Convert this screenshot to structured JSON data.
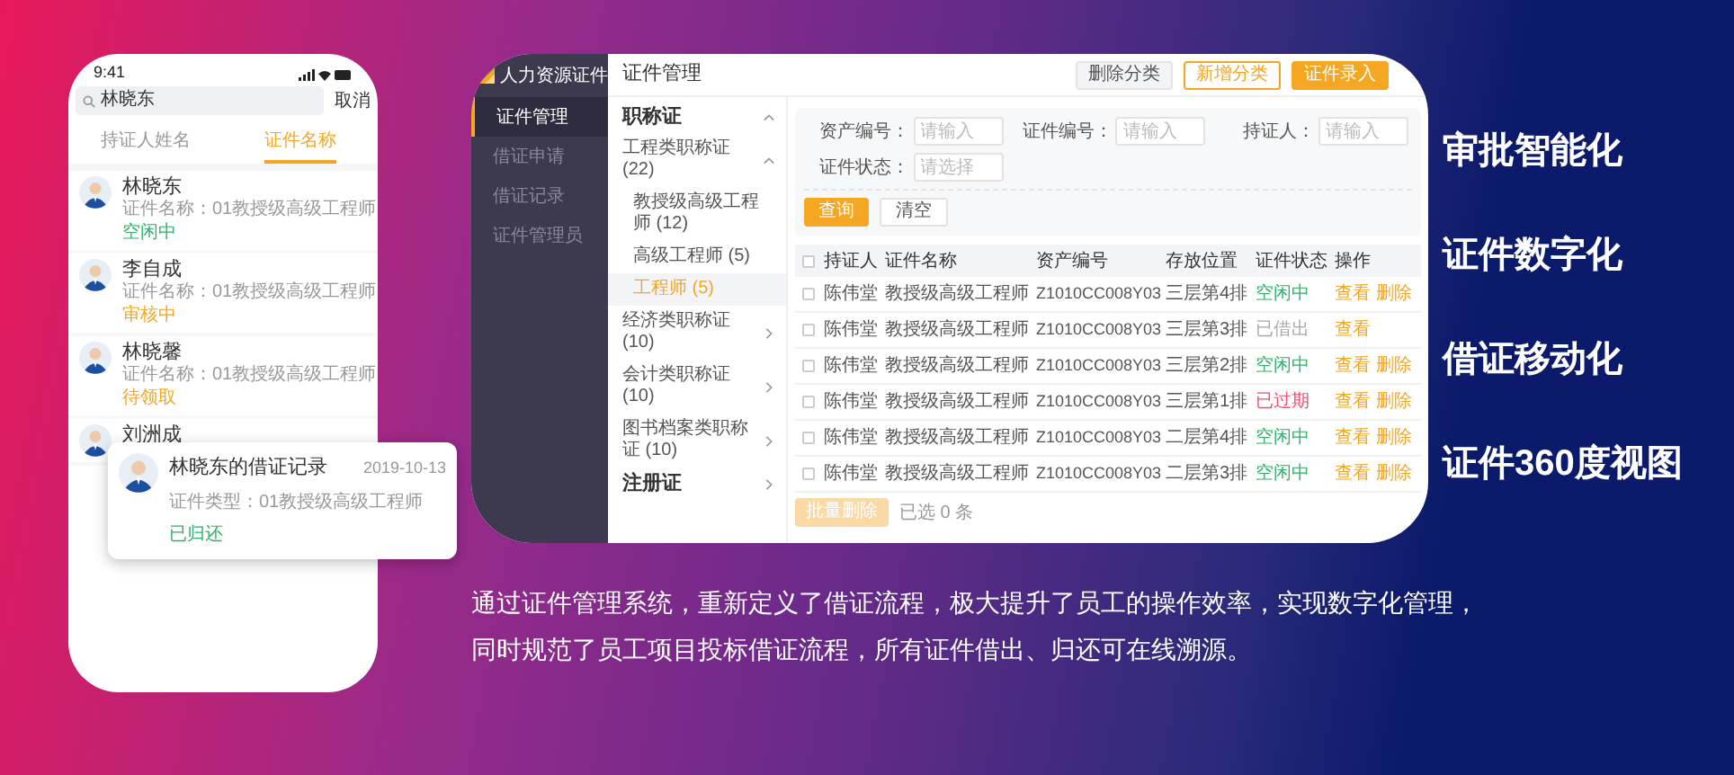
{
  "phone": {
    "time": "9:41",
    "search": {
      "value": "林晓东"
    },
    "cancel": "取消",
    "tabs": [
      {
        "label": "持证人姓名",
        "selected": false
      },
      {
        "label": "证件名称",
        "selected": true
      }
    ],
    "items": [
      {
        "name": "林晓东",
        "subtitle": "证件名称：01教授级高级工程师",
        "status": "空闲中",
        "color": "#2fb36b"
      },
      {
        "name": "李自成",
        "subtitle": "证件名称：01教授级高级工程师",
        "status": "审核中",
        "color": "#f5a623"
      },
      {
        "name": "林晓馨",
        "subtitle": "证件名称：01教授级高级工程师",
        "status": "待领取",
        "color": "#f5a623"
      },
      {
        "name": "刘洲成"
      }
    ],
    "card": {
      "title": "林晓东的借证记录",
      "date": "2019-10-13",
      "subtitle": "证件类型：01教授级高级工程师",
      "status": "已归还",
      "color": "#2fb36b"
    }
  },
  "desktop": {
    "app_name": "人力资源证件",
    "sidebar": [
      {
        "label": "证件管理",
        "selected": true
      },
      {
        "label": "借证申请",
        "selected": false
      },
      {
        "label": "借证记录",
        "selected": false
      },
      {
        "label": "证件管理员",
        "selected": false
      }
    ],
    "page_title": "证件管理",
    "buttons": [
      {
        "label": "删除分类",
        "kind": "plain"
      },
      {
        "label": "新增分类",
        "kind": "outline"
      },
      {
        "label": "证件录入",
        "kind": "primary"
      }
    ],
    "tree": [
      {
        "label": "职称证",
        "expanded": true,
        "selected": false,
        "children": [
          {
            "label": "工程类职称证 (22)",
            "expanded": true,
            "selected": false,
            "children": [
              {
                "label": "教授级高级工程师 (12)",
                "selected": false
              },
              {
                "label": "高级工程师 (5)",
                "selected": false
              },
              {
                "label": "工程师 (5)",
                "selected": true
              }
            ]
          },
          {
            "label": "经济类职称证 (10)",
            "expanded": false,
            "selected": false
          },
          {
            "label": "会计类职称证 (10)",
            "expanded": false,
            "selected": false
          },
          {
            "label": "图书档案类职称证 (10)",
            "expanded": false,
            "selected": false
          }
        ]
      },
      {
        "label": "注册证",
        "expanded": false,
        "selected": false
      }
    ],
    "filters": [
      {
        "label": "资产编号：",
        "placeholder": "请输入"
      },
      {
        "label": "证件编号：",
        "placeholder": "请输入"
      },
      {
        "label": "持证人：",
        "placeholder": "请输入"
      },
      {
        "label": "证件状态：",
        "placeholder": "请选择"
      }
    ],
    "query_button": "查询",
    "clear_button": "清空",
    "table": {
      "select_all": {
        "checked": false
      },
      "columns": [
        "持证人",
        "证件名称",
        "资产编号",
        "存放位置",
        "证件状态",
        "操作"
      ],
      "rows": [
        {
          "checked": false,
          "holder": "陈伟堂",
          "name": "教授级高级工程师",
          "asset": "Z1010CC008Y03",
          "location": "三层第4排",
          "status": "空闲中",
          "color": "#2fb36b",
          "actions": [
            "查看",
            "删除"
          ]
        },
        {
          "checked": false,
          "holder": "陈伟堂",
          "name": "教授级高级工程师",
          "asset": "Z1010CC008Y03",
          "location": "三层第3排",
          "status": "已借出",
          "color": "#aaaaaa",
          "actions": [
            "查看"
          ]
        },
        {
          "checked": false,
          "holder": "陈伟堂",
          "name": "教授级高级工程师",
          "asset": "Z1010CC008Y03",
          "location": "三层第2排",
          "status": "空闲中",
          "color": "#2fb36b",
          "actions": [
            "查看",
            "删除"
          ]
        },
        {
          "checked": false,
          "holder": "陈伟堂",
          "name": "教授级高级工程师",
          "asset": "Z1010CC008Y03",
          "location": "三层第1排",
          "status": "已过期",
          "color": "#f0506e",
          "actions": [
            "查看",
            "删除"
          ]
        },
        {
          "checked": false,
          "holder": "陈伟堂",
          "name": "教授级高级工程师",
          "asset": "Z1010CC008Y03",
          "location": "二层第4排",
          "status": "空闲中",
          "color": "#2fb36b",
          "actions": [
            "查看",
            "删除"
          ]
        },
        {
          "checked": false,
          "holder": "陈伟堂",
          "name": "教授级高级工程师",
          "asset": "Z1010CC008Y03",
          "location": "二层第3排",
          "status": "空闲中",
          "color": "#2fb36b",
          "actions": [
            "查看",
            "删除"
          ]
        }
      ]
    },
    "batch_delete": {
      "label": "批量删除",
      "disabled": true
    },
    "selected_count": "已选 0 条"
  },
  "description": [
    "通过证件管理系统，重新定义了借证流程，极大提升了员工的操作效率，实现数字化管理，",
    "同时规范了员工项目投标借证流程，所有证件借出、归还可在线溯源。"
  ],
  "features": [
    "审批智能化",
    "证件数字化",
    "借证移动化",
    "证件360度视图"
  ]
}
